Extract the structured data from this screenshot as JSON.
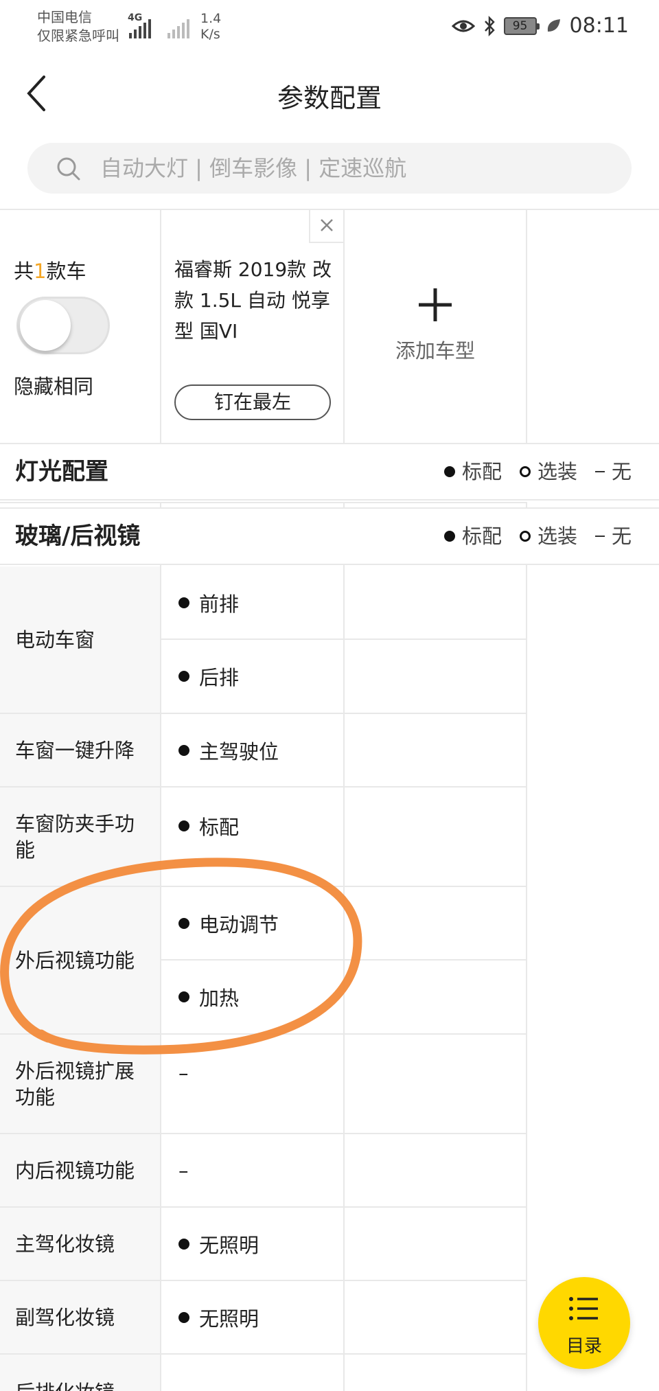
{
  "status_bar": {
    "carrier_line1": "中国电信",
    "carrier_line2": "仅限紧急呼叫",
    "network": "4G",
    "speed_value": "1.4",
    "speed_unit": "K/s",
    "battery": "95",
    "time": "08:11"
  },
  "header": {
    "title": "参数配置"
  },
  "search": {
    "placeholder": "自动大灯 | 倒车影像 | 定速巡航"
  },
  "compare_header": {
    "count_prefix": "共",
    "count_num": "1",
    "count_suffix": "款车",
    "hide_same_label": "隐藏相同",
    "hide_same_on": false,
    "car_name": "福睿斯 2019款 改款 1.5L 自动 悦享型 国VI",
    "pin_label": "钉在最左",
    "add_label": "添加车型"
  },
  "legend": {
    "standard": "标配",
    "optional": "选装",
    "none": "无"
  },
  "sections": {
    "lighting": "灯光配置",
    "glass": "玻璃/后视镜"
  },
  "rows": {
    "power_windows": {
      "label": "电动车窗",
      "values": [
        "前排",
        "后排"
      ]
    },
    "one_touch": {
      "label": "车窗一键升降",
      "value": "主驾驶位"
    },
    "anti_pinch": {
      "label": "车窗防夹手功能",
      "value": "标配"
    },
    "mirror_func": {
      "label": "外后视镜功能",
      "values": [
        "电动调节",
        "加热"
      ]
    },
    "mirror_ext": {
      "label": "外后视镜扩展功能",
      "value": "–"
    },
    "inner_mirror": {
      "label": "内后视镜功能",
      "value": "–"
    },
    "driver_vanity": {
      "label": "主驾化妆镜",
      "value": "无照明"
    },
    "passenger_vanity": {
      "label": "副驾化妆镜",
      "value": "无照明"
    },
    "rear_vanity": {
      "label": "后排化妆镜"
    }
  },
  "fab": {
    "label": "目录"
  },
  "colors": {
    "accent_yellow": "#ffd800",
    "count_orange": "#f5a623",
    "annotation_orange": "#f28a3a"
  }
}
